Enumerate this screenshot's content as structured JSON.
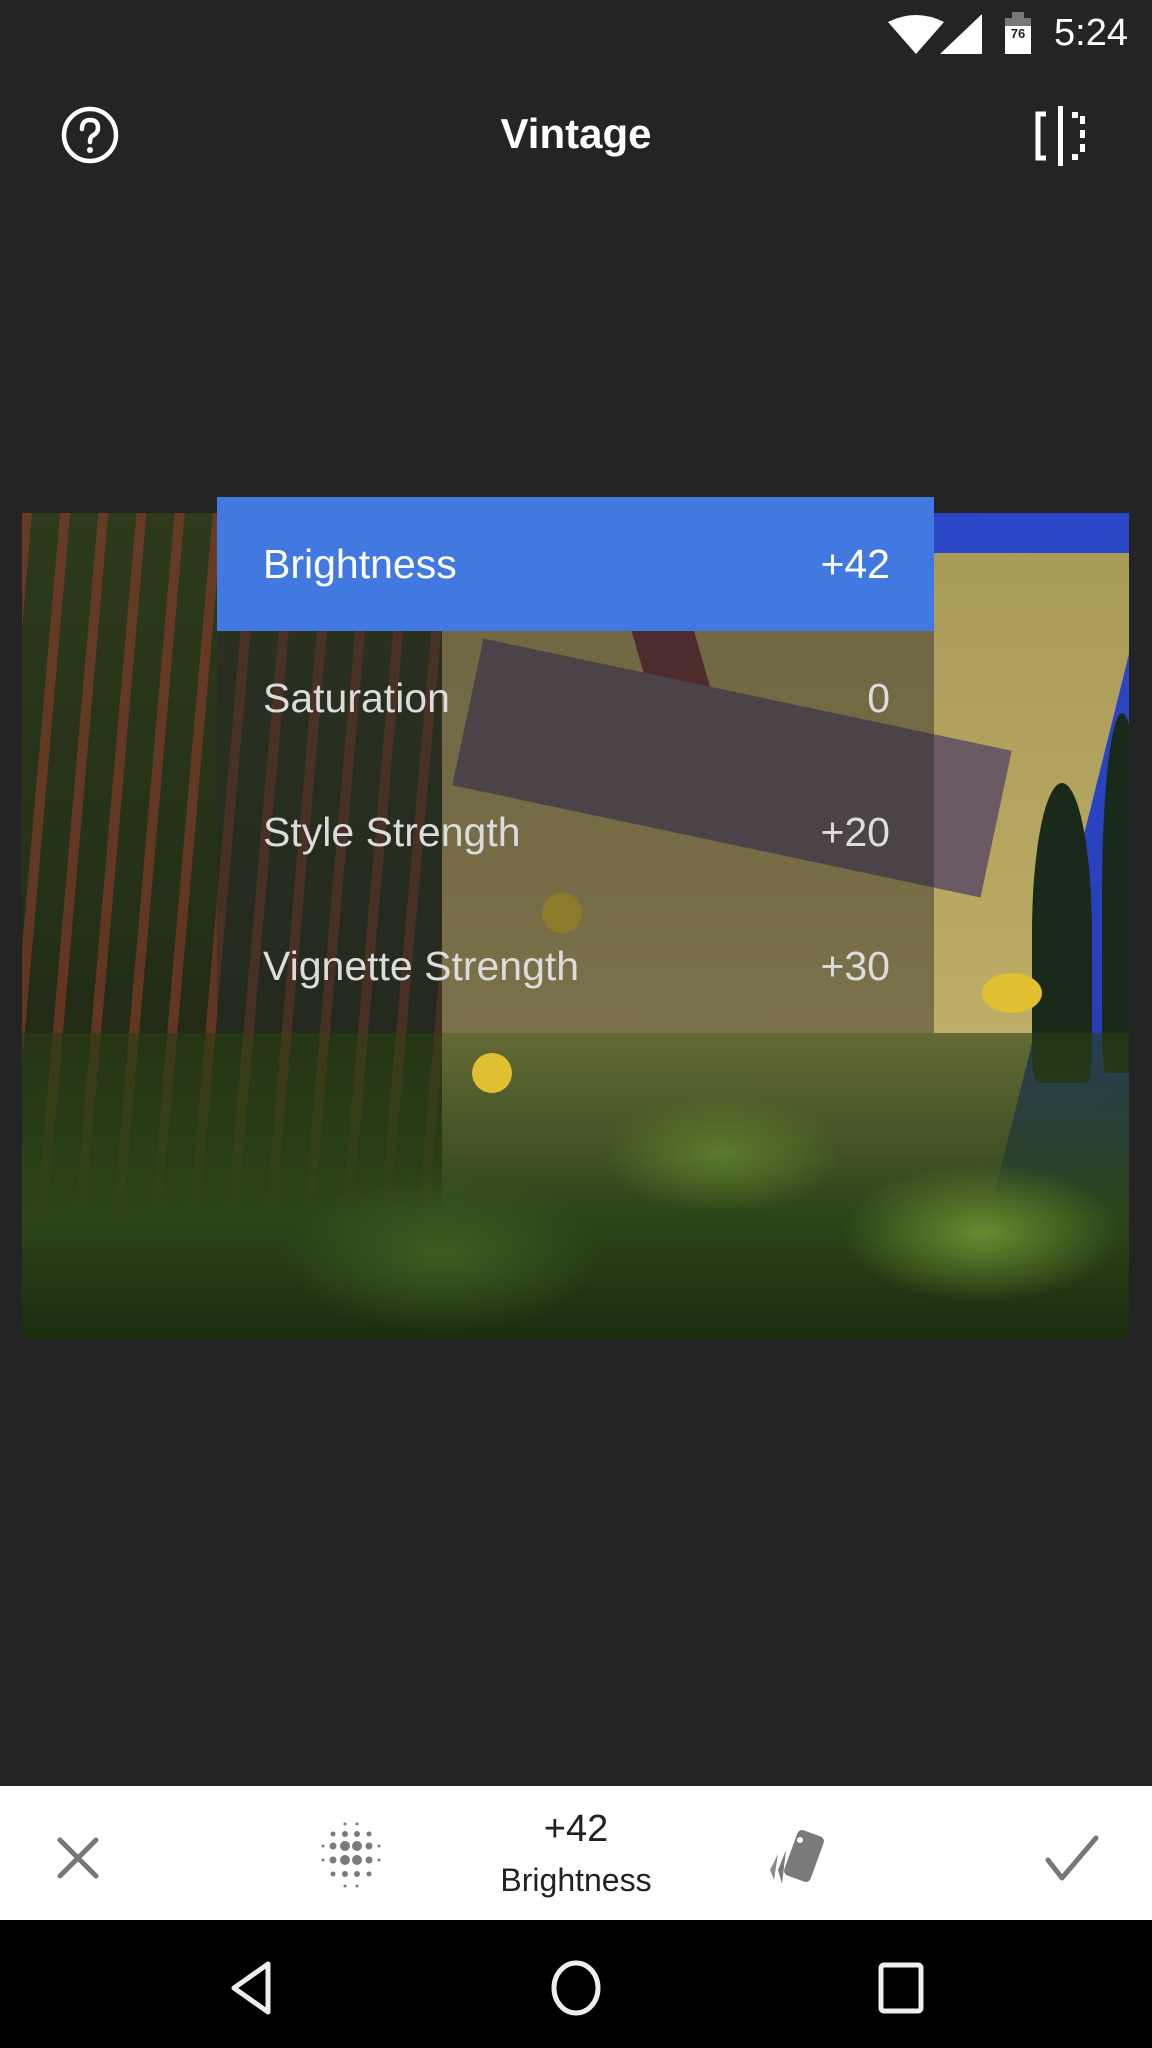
{
  "status_bar": {
    "time": "5:24",
    "battery_level": "76",
    "icons": [
      "wifi-icon",
      "cellular-signal-icon",
      "battery-icon"
    ]
  },
  "header": {
    "title": "Vintage",
    "help_icon": "help-circle-icon",
    "compare_icon": "compare-split-icon"
  },
  "adjust_menu": {
    "items": [
      {
        "label": "Brightness",
        "value": "+42",
        "active": true
      },
      {
        "label": "Saturation",
        "value": "0",
        "active": false
      },
      {
        "label": "Style Strength",
        "value": "+20",
        "active": false
      },
      {
        "label": "Vignette Strength",
        "value": "+30",
        "active": false
      }
    ],
    "active_color": "#4179e0"
  },
  "toolbar": {
    "cancel_icon": "close-icon",
    "adjust_icon": "dot-grid-adjust-icon",
    "value": "+42",
    "parameter": "Brightness",
    "styles_icon": "style-cards-icon",
    "apply_icon": "checkmark-icon"
  },
  "nav_bar": {
    "icons": [
      "back-icon",
      "home-icon",
      "recents-icon"
    ]
  }
}
